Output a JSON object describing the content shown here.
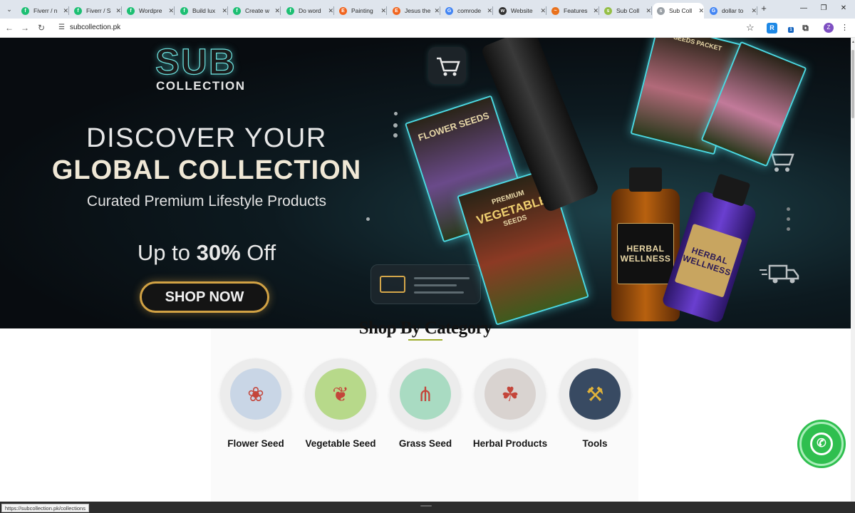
{
  "browser": {
    "tabs": [
      {
        "label": "Fiverr / n",
        "color": "#1dbf73",
        "glyph": "f"
      },
      {
        "label": "Fiverr / S",
        "color": "#1dbf73",
        "glyph": "f"
      },
      {
        "label": "Wordpre",
        "color": "#1dbf73",
        "glyph": "f"
      },
      {
        "label": "Build lux",
        "color": "#1dbf73",
        "glyph": "f"
      },
      {
        "label": "Create w",
        "color": "#1dbf73",
        "glyph": "f"
      },
      {
        "label": "Do word",
        "color": "#1dbf73",
        "glyph": "f"
      },
      {
        "label": "Painting",
        "color": "#f1641e",
        "glyph": "E"
      },
      {
        "label": "Jesus the",
        "color": "#f1641e",
        "glyph": "E"
      },
      {
        "label": "comrode",
        "color": "#4285f4",
        "glyph": "G"
      },
      {
        "label": "Website",
        "color": "#333333",
        "glyph": "w"
      },
      {
        "label": "Features",
        "color": "#e9711c",
        "glyph": "~"
      },
      {
        "label": "Sub Coll",
        "color": "#95bf47",
        "glyph": "s"
      },
      {
        "label": "Sub Coll",
        "color": "#9aa0a6",
        "glyph": "s",
        "active": true
      },
      {
        "label": "dollar to",
        "color": "#4285f4",
        "glyph": "G"
      }
    ],
    "url": "subcollection.pk",
    "profile_initial": "Z",
    "extension_badge": "1",
    "status_url": "https://subcollection.pk/collections"
  },
  "hero": {
    "logo_main": "SUB",
    "logo_sub": "COLLECTION",
    "headline_1": "DISCOVER YOUR",
    "headline_2": "GLOBAL COLLECTION",
    "subheadline": "Curated Premium Lifestyle Products",
    "offer_prefix": "Up to ",
    "offer_value": "30%",
    "offer_suffix": " Off",
    "cta": "SHOP NOW",
    "pack_flower": "FLOWER SEEDS",
    "pack_vegetable_top": "PREMIUM",
    "pack_vegetable": "VEGETABLE",
    "pack_vegetable_bottom": "SEEDS",
    "pack_small": "SEEDS PACKET",
    "bottle_1_line1": "HERBAL",
    "bottle_1_line2": "WELLNESS",
    "bottle_2_line1": "HERBAL",
    "bottle_2_line2": "WELLNESS"
  },
  "categories": {
    "title": "Shop By Category",
    "items": [
      {
        "label": "Flower Seed",
        "icon": "flower-icon",
        "glyph": "❀",
        "bg": "#c9d6e6"
      },
      {
        "label": "Vegetable Seed",
        "icon": "vegetable-icon",
        "glyph": "❦",
        "bg": "#b7d98a"
      },
      {
        "label": "Grass Seed",
        "icon": "grass-icon",
        "glyph": "⋔",
        "bg": "#a9dbc2"
      },
      {
        "label": "Herbal Products",
        "icon": "herbal-icon",
        "glyph": "☘",
        "bg": "#d9d3d0"
      },
      {
        "label": "Tools",
        "icon": "tools-icon",
        "glyph": "⚒",
        "bg": "#384a62"
      }
    ]
  }
}
